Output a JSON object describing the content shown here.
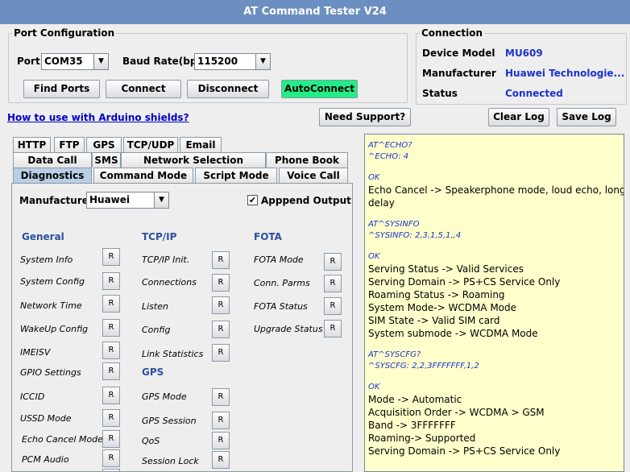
{
  "window": {
    "title": "AT Command Tester V24"
  },
  "port_config": {
    "legend": "Port Configuration",
    "port_label": "Port",
    "port_value": "COM35",
    "baud_label": "Baud Rate(bps)",
    "baud_value": "115200",
    "find_ports": "Find Ports",
    "connect": "Connect",
    "disconnect": "Disconnect",
    "autoconnect": "AutoConnect"
  },
  "connection": {
    "legend": "Connection",
    "model_label": "Device Model",
    "model_value": "MU609",
    "manufacturer_label": "Manufacturer",
    "manufacturer_value": "Huawei Technologie...",
    "status_label": "Status",
    "status_value": "Connected"
  },
  "toolbar": {
    "arduino_link": "How to use with Arduino shields?",
    "need_support": "Need Support?",
    "clear_log": "Clear Log",
    "save_log": "Save Log"
  },
  "tabs": {
    "row1": [
      "HTTP",
      "FTP",
      "GPS",
      "TCP/UDP",
      "Email"
    ],
    "row2": [
      "Data Call",
      "SMS",
      "Network Selection",
      "Phone Book"
    ],
    "row3": [
      "Diagnostics",
      "Command Mode",
      "Script Mode",
      "Voice Call"
    ],
    "active": "Diagnostics"
  },
  "diagnostics": {
    "manufacturer_label": "Manufacturer",
    "manufacturer_value": "Huawei",
    "append_output_label": "Apppend Output",
    "append_checked": true,
    "button_label": "R",
    "sections": {
      "general": "General",
      "tcpip": "TCP/IP",
      "fota": "FOTA",
      "gps": "GPS"
    },
    "general_items": [
      "System Info",
      "System Config",
      "Network Time",
      "WakeUp Config",
      "IMEISV",
      "GPIO Settings",
      "ICCID",
      "USSD Mode",
      "Echo Cancel Mode",
      "PCM Audio"
    ],
    "tcpip_items": [
      "TCP/IP Init.",
      "Connections",
      "Listen",
      "Config",
      "Link Statistics"
    ],
    "gps_items": [
      "GPS Mode",
      "GPS Session",
      "QoS",
      "Session Lock"
    ],
    "fota_items": [
      "FOTA Mode",
      "Conn. Parms",
      "FOTA Status",
      "Upgrade Status"
    ]
  },
  "log": {
    "lines": [
      {
        "t": "cmd",
        "v": "AT^ECHO?"
      },
      {
        "t": "cmd",
        "v": "^ECHO: 4"
      },
      {
        "t": "blank",
        "v": ""
      },
      {
        "t": "cmd",
        "v": "OK"
      },
      {
        "t": "text",
        "v": "Echo Cancel -> Speakerphone mode, loud echo, long"
      },
      {
        "t": "text",
        "v": "delay"
      },
      {
        "t": "blank",
        "v": ""
      },
      {
        "t": "cmd",
        "v": "AT^SYSINFO"
      },
      {
        "t": "cmd",
        "v": "^SYSINFO: 2,3,1,5,1,,4"
      },
      {
        "t": "blank",
        "v": ""
      },
      {
        "t": "cmd",
        "v": "OK"
      },
      {
        "t": "text",
        "v": "Serving Status -> Valid Services"
      },
      {
        "t": "text",
        "v": "Serving Domain -> PS+CS Service Only"
      },
      {
        "t": "text",
        "v": "Roaming Status -> Roaming"
      },
      {
        "t": "text",
        "v": "System Mode-> WCDMA Mode"
      },
      {
        "t": "text",
        "v": "SIM State -> Valid SIM card"
      },
      {
        "t": "text",
        "v": "System submode -> WCDMA Mode"
      },
      {
        "t": "blank",
        "v": ""
      },
      {
        "t": "cmd",
        "v": "AT^SYSCFG?"
      },
      {
        "t": "cmd",
        "v": "^SYSCFG: 2,2,3FFFFFFF,1,2"
      },
      {
        "t": "blank",
        "v": ""
      },
      {
        "t": "cmd",
        "v": "OK"
      },
      {
        "t": "text",
        "v": "Mode -> Automatic"
      },
      {
        "t": "text",
        "v": "Acquisition Order -> WCDMA > GSM"
      },
      {
        "t": "text",
        "v": "Band -> 3FFFFFFF"
      },
      {
        "t": "text",
        "v": "Roaming-> Supported"
      },
      {
        "t": "text",
        "v": "Serving Domain -> PS+CS Service Only"
      }
    ]
  },
  "colors": {
    "titlebar": "#6b8fc0",
    "autoconnect": "#22ee88",
    "log_bg": "#ffffcc",
    "value_blue": "#1a33cc",
    "section_blue": "#2b4f9e"
  }
}
